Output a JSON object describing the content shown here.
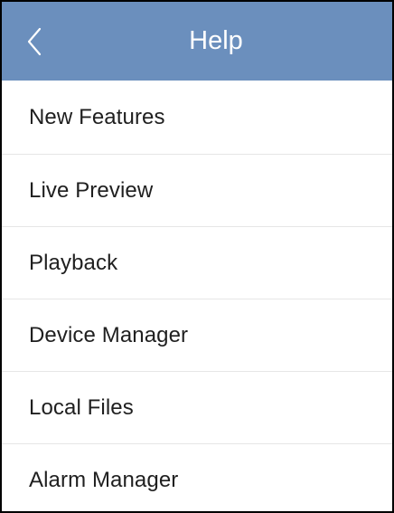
{
  "header": {
    "title": "Help",
    "back_icon": "chevron-left-icon",
    "background_color": "#6b8fbd",
    "text_color": "#ffffff"
  },
  "menu": {
    "items": [
      {
        "label": "New Features"
      },
      {
        "label": "Live Preview"
      },
      {
        "label": "Playback"
      },
      {
        "label": "Device Manager"
      },
      {
        "label": "Local Files"
      },
      {
        "label": "Alarm Manager"
      }
    ]
  }
}
